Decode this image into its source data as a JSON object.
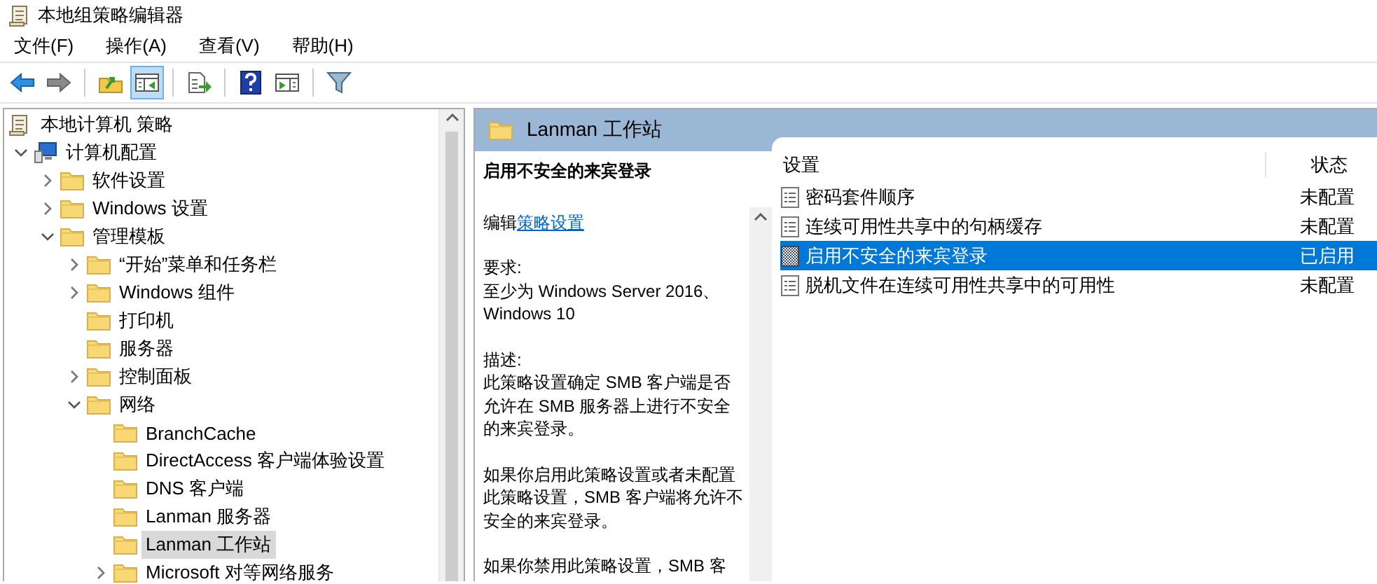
{
  "window": {
    "title": "本地组策略编辑器"
  },
  "menu": [
    {
      "label": "文件(F)"
    },
    {
      "label": "操作(A)"
    },
    {
      "label": "查看(V)"
    },
    {
      "label": "帮助(H)"
    }
  ],
  "toolbar": [
    [
      {
        "kind": "back",
        "pressed": false
      },
      {
        "kind": "forward",
        "pressed": false
      }
    ],
    [
      {
        "kind": "up",
        "pressed": false
      },
      {
        "kind": "tree",
        "pressed": true
      }
    ],
    [
      {
        "kind": "export",
        "pressed": false
      }
    ],
    [
      {
        "kind": "help",
        "pressed": false
      },
      {
        "kind": "pane",
        "pressed": false
      }
    ],
    [
      {
        "kind": "filter",
        "pressed": false
      }
    ]
  ],
  "tree": [
    {
      "label": "本地计算机 策略",
      "kind": "policy",
      "selected": false,
      "children": [
        {
          "label": "计算机配置",
          "kind": "computer",
          "expanded": true,
          "selected": false,
          "children": [
            {
              "label": "软件设置",
              "kind": "folder",
              "expanded": false,
              "selected": false
            },
            {
              "label": "Windows 设置",
              "kind": "folder",
              "expanded": false,
              "selected": false
            },
            {
              "label": "管理模板",
              "kind": "folder",
              "expanded": true,
              "selected": false,
              "children": [
                {
                  "label": "“开始”菜单和任务栏",
                  "kind": "folder",
                  "expanded": false,
                  "selected": false
                },
                {
                  "label": "Windows 组件",
                  "kind": "folder",
                  "expanded": false,
                  "selected": false
                },
                {
                  "label": "打印机",
                  "kind": "folder",
                  "selected": false
                },
                {
                  "label": "服务器",
                  "kind": "folder",
                  "selected": false
                },
                {
                  "label": "控制面板",
                  "kind": "folder",
                  "expanded": false,
                  "selected": false
                },
                {
                  "label": "网络",
                  "kind": "folder",
                  "expanded": true,
                  "selected": false,
                  "children": [
                    {
                      "label": "BranchCache",
                      "kind": "folder",
                      "selected": false
                    },
                    {
                      "label": "DirectAccess 客户端体验设置",
                      "kind": "folder",
                      "selected": false
                    },
                    {
                      "label": "DNS 客户端",
                      "kind": "folder",
                      "selected": false
                    },
                    {
                      "label": "Lanman 服务器",
                      "kind": "folder",
                      "selected": false
                    },
                    {
                      "label": "Lanman 工作站",
                      "kind": "folder",
                      "selected": true
                    },
                    {
                      "label": "Microsoft 对等网络服务",
                      "kind": "folder",
                      "expanded": false,
                      "selected": false
                    }
                  ]
                }
              ]
            }
          ]
        }
      ]
    }
  ],
  "details": {
    "header": "Lanman 工作站",
    "description": {
      "title": "启用不安全的来宾登录",
      "edit_prefix": "编辑",
      "edit_link": "策略设置",
      "paragraphs": [
        [
          "要求:",
          "至少为 Windows Server 2016、Windows 10"
        ],
        [
          "描述:",
          "此策略设置确定 SMB 客户端是否允许在 SMB 服务器上进行不安全的来宾登录。"
        ],
        [
          "如果你启用此策略设置或者未配置此策略设置，SMB 客户端将允许不安全的来宾登录。"
        ],
        [
          "如果你禁用此策略设置，SMB 客"
        ]
      ]
    },
    "list": {
      "columns": [
        "设置",
        "状态"
      ],
      "rows": [
        {
          "name": "密码套件顺序",
          "status": "未配置",
          "kind": "setting",
          "selected": false
        },
        {
          "name": "连续可用性共享中的句柄缓存",
          "status": "未配置",
          "kind": "setting",
          "selected": false
        },
        {
          "name": "启用不安全的来宾登录",
          "status": "已启用",
          "kind": "enabled",
          "selected": true
        },
        {
          "name": "脱机文件在连续可用性共享中的可用性",
          "status": "未配置",
          "kind": "setting",
          "selected": false
        }
      ]
    }
  }
}
